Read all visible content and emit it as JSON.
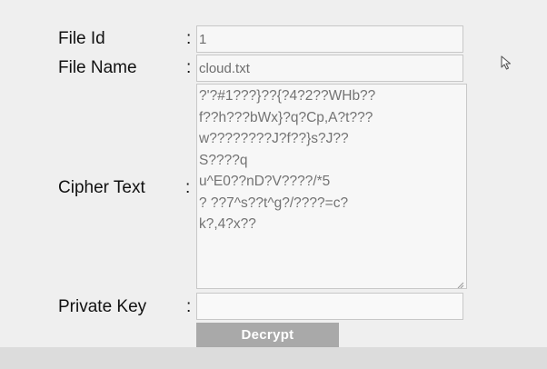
{
  "form": {
    "file_id": {
      "label": "File Id",
      "value": "1"
    },
    "file_name": {
      "label": "File Name",
      "value": "cloud.txt"
    },
    "cipher_text": {
      "label": "Cipher Text",
      "value": "?'?#1???}??{?4?2??WHb??\nf??h???bWx}?q?Cp,A?t???\nw????????J?f??}s?J??\nS????q\nu^E0??nD?V????/*5\n? ??7^s??t^g?/????=c?\nk?,4?x??"
    },
    "private_key": {
      "label": "Private Key",
      "value": ""
    },
    "separator": ":"
  },
  "actions": {
    "decrypt_label": "Decrypt"
  },
  "colors": {
    "background": "#efefef",
    "field_background": "#f7f7f7",
    "field_border": "#c8c8c8",
    "button_background": "#a9a9a9",
    "button_text": "#ffffff"
  },
  "icons": {
    "pointer": "mouse-pointer-icon"
  }
}
